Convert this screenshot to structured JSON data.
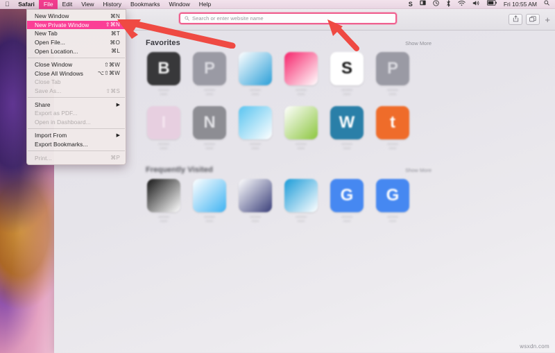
{
  "menubar": {
    "apple_logo": "apple-logo",
    "app_name": "Safari",
    "items": [
      {
        "label": "File",
        "active": true
      },
      {
        "label": "Edit",
        "active": false
      },
      {
        "label": "View",
        "active": false
      },
      {
        "label": "History",
        "active": false
      },
      {
        "label": "Bookmarks",
        "active": false
      },
      {
        "label": "Window",
        "active": false
      },
      {
        "label": "Help",
        "active": false
      }
    ],
    "status_items": [
      {
        "name": "skype-icon",
        "glyph": "S"
      },
      {
        "name": "display-icon",
        "glyph": "⊡"
      },
      {
        "name": "time-machine-icon",
        "glyph": "↺"
      },
      {
        "name": "bluetooth-icon",
        "glyph": "✶"
      },
      {
        "name": "wifi-icon",
        "glyph": "◠"
      },
      {
        "name": "volume-icon",
        "glyph": "◂"
      },
      {
        "name": "battery-icon",
        "glyph": "▭"
      }
    ],
    "clock": "Fri 10:55 AM",
    "spotlight": "spotlight-icon"
  },
  "file_menu": {
    "items": [
      {
        "label": "New Window",
        "shortcut": "⌘N",
        "disabled": false,
        "highlight": false,
        "submenu": false
      },
      {
        "label": "New Private Window",
        "shortcut": "⇧⌘N",
        "disabled": false,
        "highlight": true,
        "submenu": false
      },
      {
        "label": "New Tab",
        "shortcut": "⌘T",
        "disabled": false,
        "highlight": false,
        "submenu": false
      },
      {
        "label": "Open File...",
        "shortcut": "⌘O",
        "disabled": false,
        "highlight": false,
        "submenu": false
      },
      {
        "label": "Open Location...",
        "shortcut": "⌘L",
        "disabled": false,
        "highlight": false,
        "submenu": false
      },
      {
        "separator": true
      },
      {
        "label": "Close Window",
        "shortcut": "⇧⌘W",
        "disabled": false,
        "highlight": false,
        "submenu": false
      },
      {
        "label": "Close All Windows",
        "shortcut": "⌥⇧⌘W",
        "disabled": false,
        "highlight": false,
        "submenu": false
      },
      {
        "label": "Close Tab",
        "shortcut": "",
        "disabled": true,
        "highlight": false,
        "submenu": false
      },
      {
        "label": "Save As...",
        "shortcut": "⇧⌘S",
        "disabled": true,
        "highlight": false,
        "submenu": false
      },
      {
        "separator": true
      },
      {
        "label": "Share",
        "shortcut": "",
        "disabled": false,
        "highlight": false,
        "submenu": true
      },
      {
        "label": "Export as PDF...",
        "shortcut": "",
        "disabled": true,
        "highlight": false,
        "submenu": false
      },
      {
        "label": "Open in Dashboard...",
        "shortcut": "",
        "disabled": true,
        "highlight": false,
        "submenu": false
      },
      {
        "separator": true
      },
      {
        "label": "Import From",
        "shortcut": "",
        "disabled": false,
        "highlight": false,
        "submenu": true
      },
      {
        "label": "Export Bookmarks...",
        "shortcut": "",
        "disabled": false,
        "highlight": false,
        "submenu": false
      },
      {
        "separator": true
      },
      {
        "label": "Print...",
        "shortcut": "⌘P",
        "disabled": true,
        "highlight": false,
        "submenu": false
      }
    ]
  },
  "toolbar": {
    "address_placeholder": "Search or enter website name",
    "address_value": "",
    "search_icon": "search-icon",
    "share_icon": "share-icon",
    "tabs_icon": "tab-overview-icon",
    "newtab_label": "+",
    "highlight_color": "#f0608f"
  },
  "startpage": {
    "favorites": {
      "title": "Favorites",
      "show_more": "Show More",
      "tiles": [
        {
          "name": "favorite-tile-1",
          "glyph": "B",
          "bg": "#38383a",
          "fg": "#f2f2f2",
          "label": ""
        },
        {
          "name": "favorite-tile-2",
          "glyph": "P",
          "bg": "#9a9aa4",
          "fg": "#d8d8de",
          "label": ""
        },
        {
          "name": "favorite-tile-3",
          "glyph": "",
          "bg": "#ffffff",
          "fg": "#2b9fd8",
          "label": ""
        },
        {
          "name": "favorite-tile-4",
          "glyph": "",
          "bg": "#f6246b",
          "fg": "#ffffff",
          "label": ""
        },
        {
          "name": "favorite-tile-5",
          "glyph": "S",
          "bg": "#ffffff",
          "fg": "#111111",
          "label": ""
        },
        {
          "name": "favorite-tile-6",
          "glyph": "P",
          "bg": "#9a9aa4",
          "fg": "#d8d8de",
          "label": ""
        },
        {
          "name": "favorite-tile-7",
          "glyph": "I",
          "bg": "#e7cfe0",
          "fg": "#f4e4ef",
          "label": ""
        },
        {
          "name": "favorite-tile-8",
          "glyph": "N",
          "bg": "#8d8d93",
          "fg": "#e2e2e6",
          "label": ""
        },
        {
          "name": "favorite-tile-9",
          "glyph": "",
          "bg": "#59c4f0",
          "fg": "#ffffff",
          "label": ""
        },
        {
          "name": "favorite-tile-10",
          "glyph": "",
          "bg": "#ffffff",
          "fg": "#8cc63f",
          "label": ""
        },
        {
          "name": "favorite-tile-11",
          "glyph": "W",
          "bg": "#2a7fa8",
          "fg": "#ffffff",
          "label": ""
        },
        {
          "name": "favorite-tile-12",
          "glyph": "t",
          "bg": "#ef6c2a",
          "fg": "#ffffff",
          "label": ""
        }
      ]
    },
    "frequently_visited": {
      "title": "Frequently Visited",
      "show_more": "Show More",
      "tiles": [
        {
          "name": "frequent-tile-1",
          "glyph": "",
          "bg": "#171717",
          "fg": "#ffffff",
          "label": ""
        },
        {
          "name": "frequent-tile-2",
          "glyph": "",
          "bg": "#ffffff",
          "fg": "#3fb3f2",
          "label": ""
        },
        {
          "name": "frequent-tile-3",
          "glyph": "",
          "bg": "#ffffff",
          "fg": "#3a3f7a",
          "label": ""
        },
        {
          "name": "frequent-tile-4",
          "glyph": "",
          "bg": "#1b9bd8",
          "fg": "#ffffff",
          "label": ""
        },
        {
          "name": "frequent-tile-5",
          "glyph": "G",
          "bg": "#4688f1",
          "fg": "#ffffff",
          "label": ""
        },
        {
          "name": "frequent-tile-6",
          "glyph": "G",
          "bg": "#4688f1",
          "fg": "#ffffff",
          "label": ""
        }
      ]
    }
  },
  "annotations": {
    "arrow_color": "#ef4a43",
    "arrow1_target": "New Private Window",
    "arrow2_target": "address-bar"
  },
  "watermark": "wsxdn.com"
}
